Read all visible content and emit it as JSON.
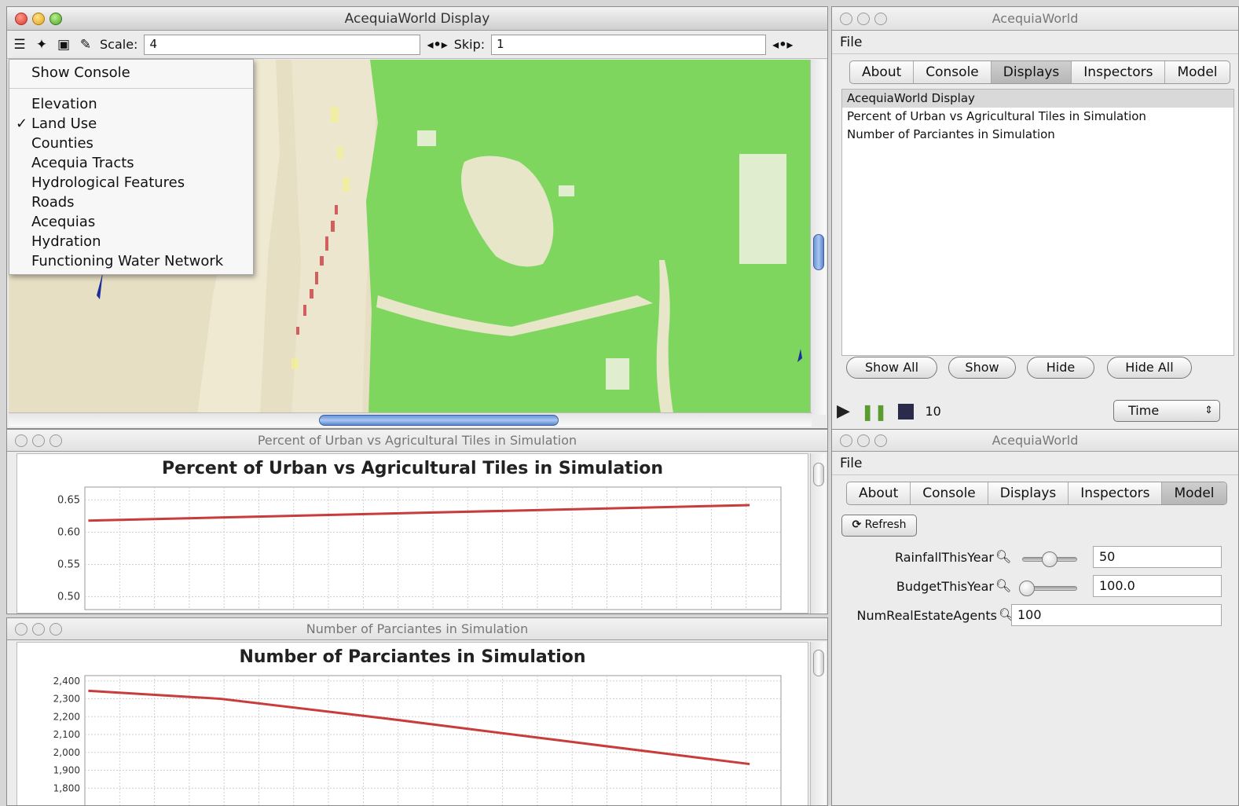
{
  "display_window": {
    "title": "AcequiaWorld Display",
    "scale_label": "Scale:",
    "scale_value": "4",
    "skip_label": "Skip:",
    "skip_value": "1",
    "layers_menu": {
      "show_console": "Show Console",
      "items": [
        {
          "label": "Elevation",
          "checked": false
        },
        {
          "label": "Land Use",
          "checked": true
        },
        {
          "label": "Counties",
          "checked": false
        },
        {
          "label": "Acequia Tracts",
          "checked": false
        },
        {
          "label": "Hydrological Features",
          "checked": false
        },
        {
          "label": "Roads",
          "checked": false
        },
        {
          "label": "Acequias",
          "checked": false
        },
        {
          "label": "Hydration",
          "checked": false
        },
        {
          "label": "Functioning Water Network",
          "checked": false
        }
      ]
    }
  },
  "chart1": {
    "window_title": "Percent of Urban vs Agricultural Tiles in Simulation",
    "chart_data": {
      "type": "line",
      "title": "Percent of Urban vs Agricultural Tiles in Simulation",
      "ylim": [
        0.48,
        0.67
      ],
      "yticks": [
        "0.65",
        "0.60",
        "0.55",
        "0.50"
      ],
      "series": [
        {
          "x": [
            0,
            1
          ],
          "y": [
            0.618,
            0.642
          ]
        }
      ],
      "color": "#c83c3c"
    }
  },
  "chart2": {
    "window_title": "Number of Parciantes in Simulation",
    "chart_data": {
      "type": "line",
      "title": "Number of Parciantes in Simulation",
      "ylim": [
        1700,
        2430
      ],
      "yticks": [
        "2,400",
        "2,300",
        "2,200",
        "2,100",
        "2,000",
        "1,900",
        "1,800"
      ],
      "series": [
        {
          "x": [
            0,
            0.2,
            0.45,
            0.75,
            1
          ],
          "y": [
            2345,
            2300,
            2190,
            2050,
            1935
          ]
        }
      ],
      "color": "#c83c3c"
    }
  },
  "console_window": {
    "title": "AcequiaWorld",
    "menu_file": "File",
    "tabs": [
      "About",
      "Console",
      "Displays",
      "Inspectors",
      "Model"
    ],
    "active_tab": "Displays",
    "displays": [
      "AcequiaWorld Display",
      "Percent of Urban vs Agricultural Tiles in Simulation",
      "Number of Parciantes in Simulation"
    ],
    "buttons": {
      "show_all": "Show All",
      "show": "Show",
      "hide": "Hide",
      "hide_all": "Hide All"
    },
    "step_count": "10",
    "time_select": "Time"
  },
  "model_window": {
    "title": "AcequiaWorld",
    "menu_file": "File",
    "tabs": [
      "About",
      "Console",
      "Displays",
      "Inspectors",
      "Model"
    ],
    "active_tab": "Model",
    "refresh_label": "Refresh",
    "properties": {
      "rainfall_label": "RainfallThisYear",
      "rainfall_value": "50",
      "rainfall_slider": 0.5,
      "budget_label": "BudgetThisYear",
      "budget_value": "100.0",
      "budget_slider": 0.0,
      "agents_label": "NumRealEstateAgents",
      "agents_value": "100"
    }
  }
}
